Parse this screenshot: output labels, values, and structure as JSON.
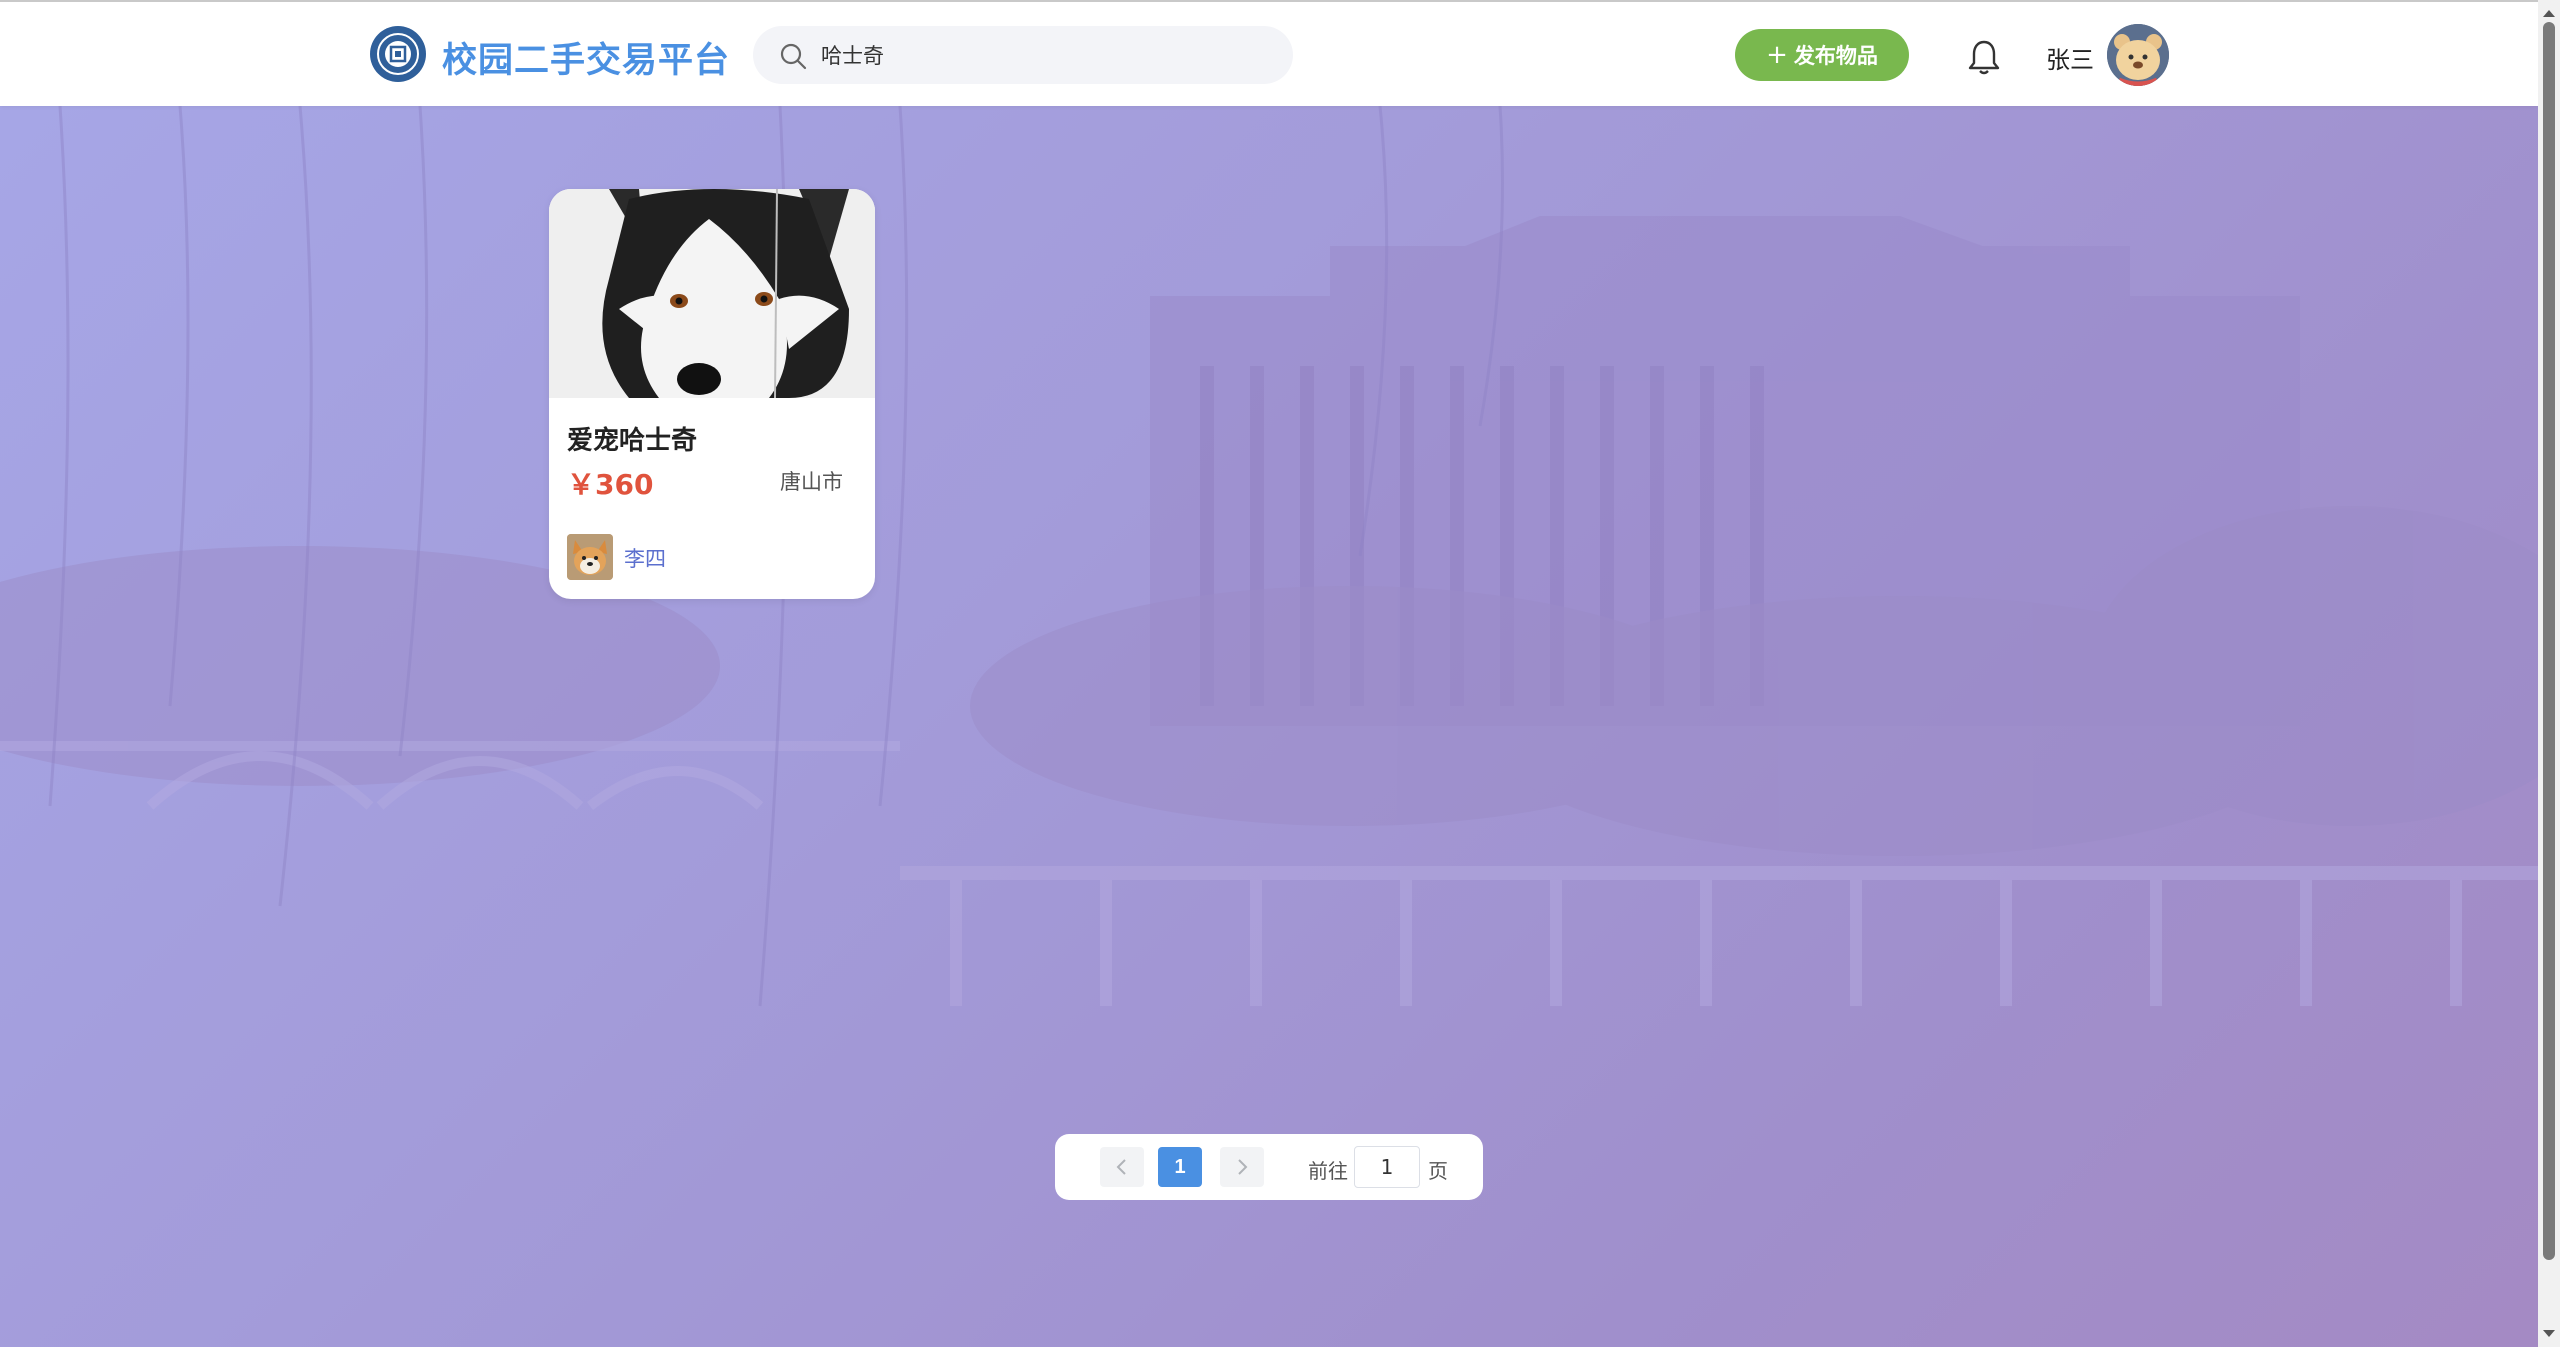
{
  "header": {
    "logo_icon": "school-emblem-icon",
    "brand": "校园二手交易平台",
    "search": {
      "value": "哈士奇",
      "icon": "search-icon"
    },
    "publish_button": {
      "icon": "plus-icon",
      "label": "发布物品"
    },
    "notification_icon": "bell-icon",
    "user": {
      "name": "张三",
      "avatar": "bear-avatar"
    }
  },
  "listings": [
    {
      "image": "husky-photo",
      "title": "爱宠哈士奇",
      "price": "￥360",
      "city": "唐山市",
      "seller": {
        "name": "李四",
        "avatar": "shiba-avatar"
      }
    }
  ],
  "pagination": {
    "prev_icon": "chevron-left-icon",
    "current_page": "1",
    "next_icon": "chevron-right-icon",
    "goto_label": "前往",
    "goto_value": "1",
    "page_unit": "页"
  },
  "colors": {
    "brand": "#4a90e2",
    "publish": "#79b84e",
    "price": "#e0533d",
    "seller_name": "#5b6fce",
    "background": "#a39bdc"
  }
}
